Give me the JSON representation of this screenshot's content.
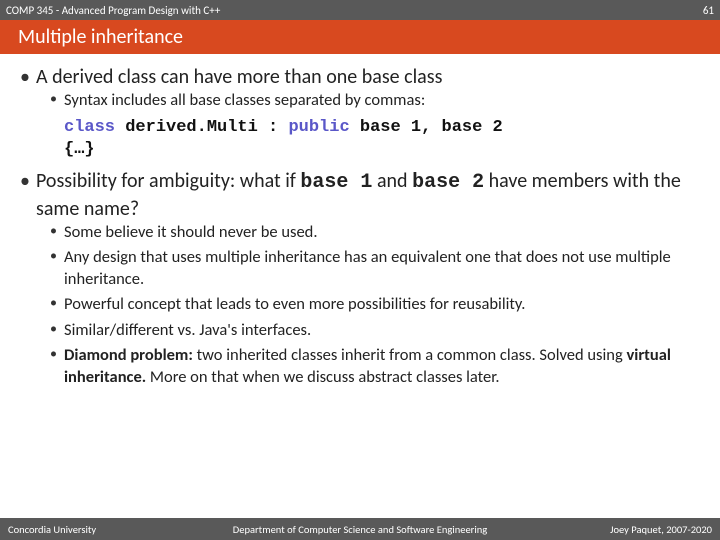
{
  "header": {
    "course": "COMP 345 - Advanced Program Design with C++",
    "page": "61"
  },
  "title": "Multiple inheritance",
  "bullets": {
    "b1": "A derived class can have more than one base class",
    "b1_1": "Syntax includes all base classes separated by commas:",
    "code_kw1": "class",
    "code_id1": " derived.Multi : ",
    "code_kw2": "public",
    "code_id2": " base 1, base 2",
    "code_line2": "{…}",
    "b2_pre": "Possibility for ambiguity: what if ",
    "b2_code1": "base 1",
    "b2_mid": " and ",
    "b2_code2": "base 2",
    "b2_post": " have members with the same name?",
    "b2_1": "Some believe it should never be used.",
    "b2_2": "Any design that uses multiple inheritance has an equivalent one that does not use multiple inheritance.",
    "b2_3": "Powerful concept that leads to even more possibilities for reusability.",
    "b2_4": "Similar/different vs. Java's interfaces.",
    "b2_5_b1": "Diamond problem:",
    "b2_5_t1": " two inherited classes inherit from a common class. Solved using ",
    "b2_5_b2": "virtual inheritance.",
    "b2_5_t2": " More on that when we discuss abstract classes later."
  },
  "footer": {
    "left": "Concordia University",
    "center": "Department of Computer Science and Software Engineering",
    "right": "Joey Paquet, 2007-2020"
  }
}
